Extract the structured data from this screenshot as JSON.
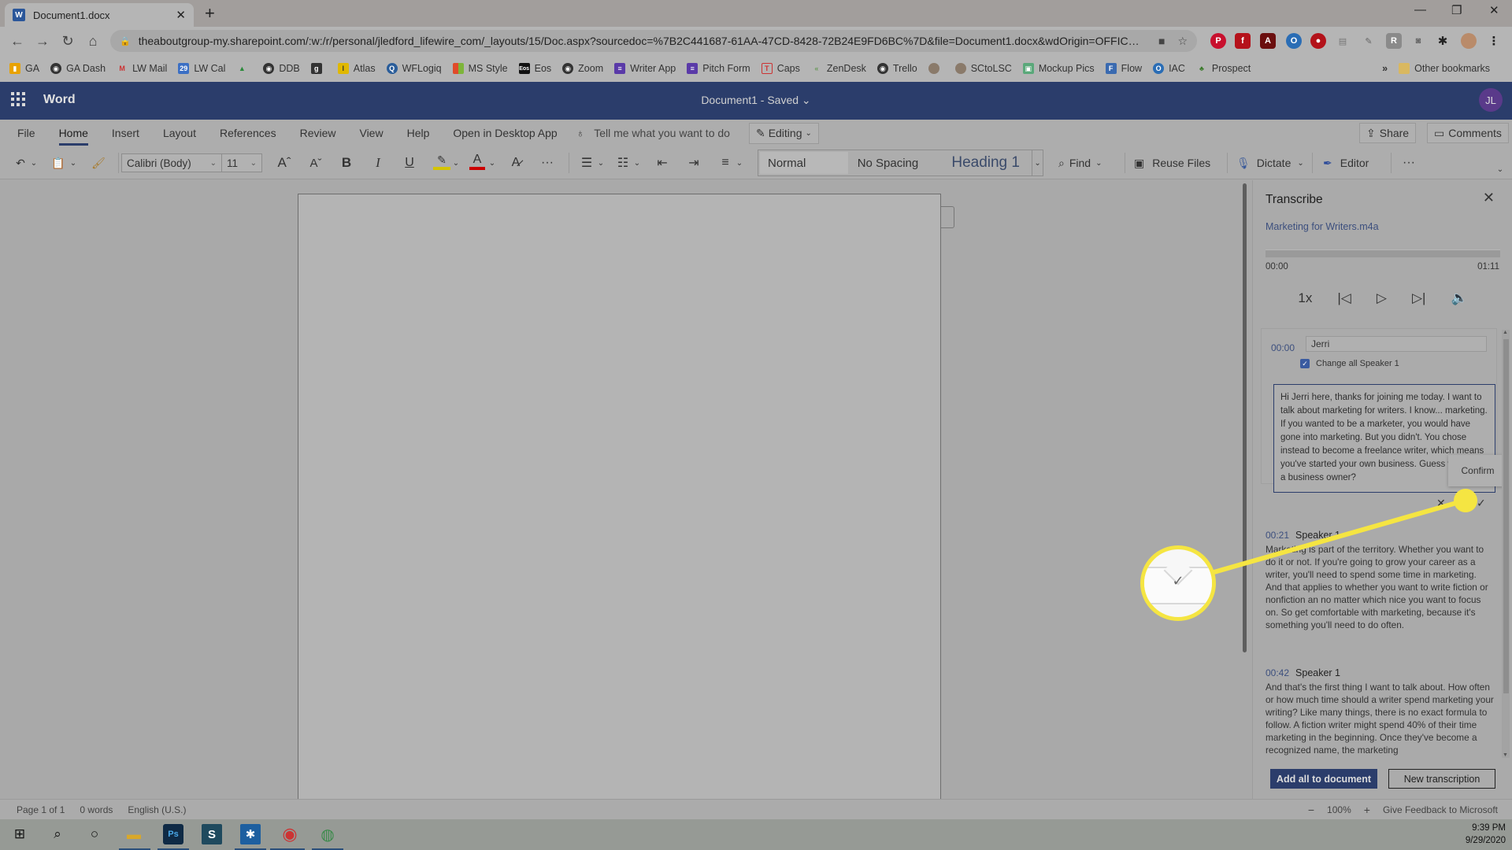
{
  "browser": {
    "tab_title": "Document1.docx",
    "url": "theaboutgroup-my.sharepoint.com/:w:/r/personal/jledford_lifewire_com/_layouts/15/Doc.aspx?sourcedoc=%7B2C441687-61AA-47CD-8428-72B24E9FD6BC%7D&file=Document1.docx&wdOrigin=OFFICEC...",
    "bookmarks": [
      "GA",
      "GA Dash",
      "LW Mail",
      "LW Cal",
      "",
      "DDB",
      "",
      "Atlas",
      "WFLogiq",
      "MS Style",
      "Eos",
      "Zoom",
      "Writer App",
      "Pitch Form",
      "Caps",
      "ZenDesk",
      "Trello",
      "",
      "SCtoLSC",
      "Mockup Pics",
      "Flow",
      "IAC",
      "Prospect"
    ],
    "other_bookmarks": "Other bookmarks",
    "more_bookmarks": "»"
  },
  "word": {
    "app_name": "Word",
    "doc_title": "Document1  -  Saved ⌄",
    "avatar_initials": "JL",
    "ribbon_tabs": [
      "File",
      "Home",
      "Insert",
      "Layout",
      "References",
      "Review",
      "View",
      "Help",
      "Open in Desktop App"
    ],
    "active_tab": "Home",
    "tell_me": "Tell me what you want to do",
    "editing": "Editing",
    "share": "Share",
    "comments": "Comments",
    "toolbar": {
      "font_name": "Calibri (Body)",
      "font_size": "11",
      "styles": [
        "Normal",
        "No Spacing",
        "Heading 1"
      ],
      "find": "Find",
      "reuse_files": "Reuse Files",
      "dictate": "Dictate",
      "editor": "Editor"
    }
  },
  "transcribe": {
    "title": "Transcribe",
    "file_name": "Marketing for Writers.m4a",
    "time_start": "00:00",
    "time_end": "01:11",
    "progress": 0,
    "speed": "1x",
    "editing_segment": {
      "time": "00:00",
      "speaker_value": "Jerri",
      "change_all_label": "Change all Speaker 1",
      "change_all_checked": true,
      "text": "Hi Jerri here, thanks for joining me today. I want to talk about marketing for writers. I know... marketing. If you wanted to be a marketer, you would have gone into marketing. But you didn't. You chose instead to become a freelance writer, which means you've started your own business. Guess what, as a business owner?",
      "confirm_tooltip": "Confirm"
    },
    "segments": [
      {
        "time": "00:21",
        "speaker": "Speaker 1",
        "text": "Marketing is part of the territory. Whether you want to do it or not. If you're going to grow your career as a writer, you'll need to spend some time in marketing. And that applies to whether you want to write fiction or nonfiction an no matter which nice you want to focus on. So get comfortable with marketing, because it's something you'll need to do often."
      },
      {
        "time": "00:42",
        "speaker": "Speaker 1",
        "text": "And that's the first thing I want to talk about. How often or how much time should a writer spend marketing your writing? Like many things, there is no exact formula to follow. A fiction writer might spend 40% of their time marketing in the beginning. Once they've become a recognized name, the marketing"
      }
    ],
    "add_all": "Add all to document",
    "new_transcription": "New transcription"
  },
  "status": {
    "page": "Page 1 of 1",
    "words": "0 words",
    "language": "English (U.S.)",
    "zoom": "100%",
    "feedback": "Give Feedback to Microsoft"
  },
  "taskbar": {
    "time": "9:39 PM",
    "date": "9/29/2020"
  },
  "colors": {
    "word_blue": "#2b579a",
    "highlight_yellow": "#f5e542"
  }
}
